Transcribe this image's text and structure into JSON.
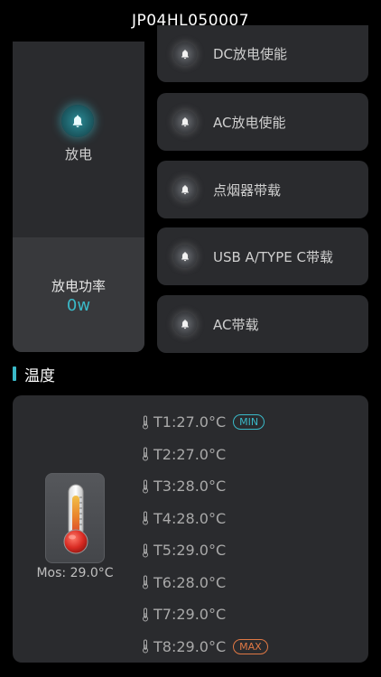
{
  "header": {
    "title": "JP04HL050007"
  },
  "discharge": {
    "label": "放电",
    "power_label": "放电功率",
    "power_value": "0w",
    "accent_color": "#3ab9c8"
  },
  "switches": [
    {
      "label": "DC放电使能",
      "icon": "bell-icon"
    },
    {
      "label": "AC放电使能",
      "icon": "bell-icon"
    },
    {
      "label": "点烟器带载",
      "icon": "bell-icon"
    },
    {
      "label": "USB A/TYPE C带载",
      "icon": "bell-icon"
    },
    {
      "label": "AC带载",
      "icon": "bell-icon"
    }
  ],
  "temperature": {
    "section_title": "温度",
    "mos": "Mos: 29.0°C",
    "readings": [
      {
        "text": "T1:27.0°C",
        "badge": "MIN"
      },
      {
        "text": "T2:27.0°C",
        "badge": ""
      },
      {
        "text": "T3:28.0°C",
        "badge": ""
      },
      {
        "text": "T4:28.0°C",
        "badge": ""
      },
      {
        "text": "T5:29.0°C",
        "badge": ""
      },
      {
        "text": "T6:28.0°C",
        "badge": ""
      },
      {
        "text": "T7:29.0°C",
        "badge": ""
      },
      {
        "text": "T8:29.0°C",
        "badge": "MAX"
      }
    ],
    "min_color": "#3ab9c8",
    "max_color": "#e07844"
  }
}
